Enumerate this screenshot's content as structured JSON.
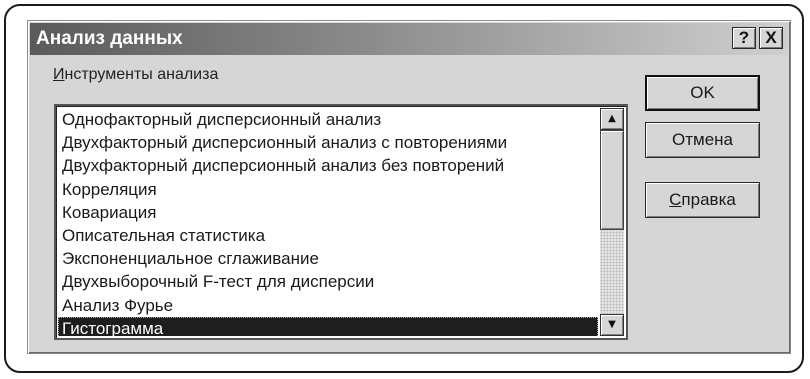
{
  "dialog": {
    "title": "Анализ данных",
    "help_glyph": "?",
    "close_glyph": "X"
  },
  "tools": {
    "label": "Инструменты анализа",
    "items": [
      "Однофакторный дисперсионный анализ",
      "Двухфакторный дисперсионный анализ с повторениями",
      "Двухфакторный дисперсионный анализ без повторений",
      "Корреляция",
      "Ковариация",
      "Описательная статистика",
      "Экспоненциальное сглаживание",
      "Двухвыборочный F-тест для дисперсии",
      "Анализ Фурье",
      "Гистограмма"
    ],
    "selected_item": "Гистограмма"
  },
  "scrollbar": {
    "up_glyph": "▲",
    "down_glyph": "▼"
  },
  "buttons": {
    "ok": "OK",
    "cancel": "Отмена",
    "help": "Справка"
  },
  "colors": {
    "dialog_bg": "#d6d6d6",
    "selection_bg": "#1e1e1e",
    "title_gradient_start": "#5a5a5a",
    "title_gradient_end": "#cfcfcf"
  },
  "icons": [
    "help-icon",
    "close-icon",
    "scroll-up-icon",
    "scroll-down-icon"
  ]
}
